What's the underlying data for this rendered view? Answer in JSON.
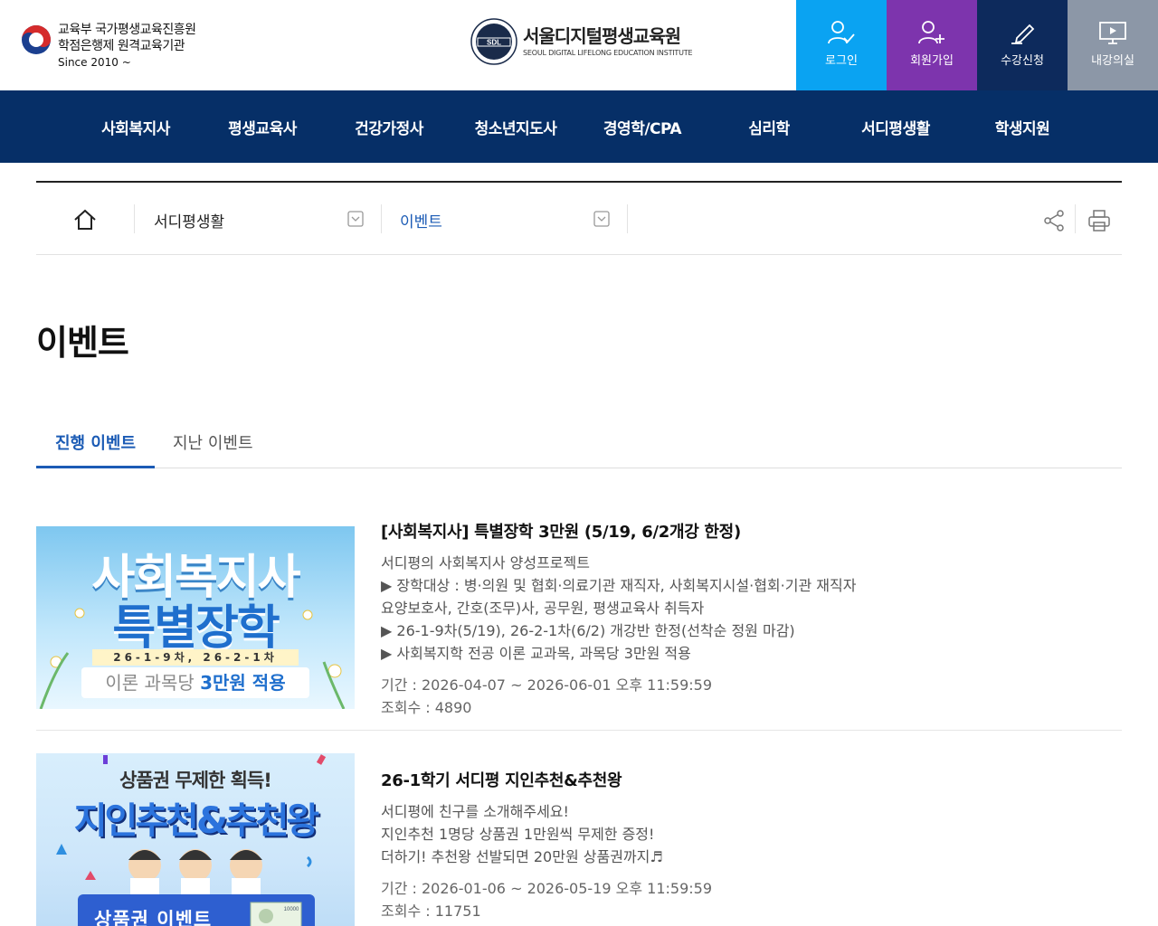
{
  "header": {
    "gov_line1": "교육부 국가평생교육진흥원",
    "gov_line2": "학점은행제 원격교육기관",
    "gov_since": "Since 2010 ~",
    "brand_name": "서울디지털평생교육원",
    "brand_sub": "SEOUL DIGITAL LIFELONG EDUCATION INSTITUTE",
    "brand_seal_text": "SDL",
    "quick": [
      {
        "label": "로그인",
        "icon": "user-check-icon",
        "color": "#0aa3f2"
      },
      {
        "label": "회원가입",
        "icon": "user-plus-icon",
        "color": "#7d34ad"
      },
      {
        "label": "수강신청",
        "icon": "pen-icon",
        "color": "#0d2a5c"
      },
      {
        "label": "내강의실",
        "icon": "monitor-icon",
        "color": "#8c97a7"
      }
    ]
  },
  "gnb": [
    "사회복지사",
    "평생교육사",
    "건강가정사",
    "청소년지도사",
    "경영학/CPA",
    "심리학",
    "서디평생활",
    "학생지원"
  ],
  "location": {
    "level1": "서디평생활",
    "level2": "이벤트"
  },
  "page_title": "이벤트",
  "tabs": [
    "진행 이벤트",
    "지난 이벤트"
  ],
  "events": [
    {
      "title": "[사회복지사] 특별장학 3만원 (5/19, 6/2개강 한정)",
      "desc": [
        "서디평의 사회복지사 양성프로젝트",
        "▶ 장학대상 : 병·의원 및 협회·의료기관 재직자, 사회복지시설·협회·기관 재직자",
        "요양보호사, 간호(조무)사, 공무원, 평생교육사 취득자",
        "▶ 26-1-9차(5/19), 26-2-1차(6/2) 개강반 한정(선착순 정원 마감)",
        "▶ 사회복지학 전공 이론 교과목, 과목당 3만원 적용"
      ],
      "period": "기간 : 2026-04-07 ~ 2026-06-01 오후 11:59:59",
      "views": "조회수 : 4890",
      "thumb": {
        "line1": "사회복지사",
        "line2": "특별장학",
        "band": "26-1-9차, 26-2-1차",
        "strip_prefix": "이론 과목당 ",
        "strip_bold": "3만원 적용"
      }
    },
    {
      "title": "26-1학기 서디평 지인추천&추천왕",
      "desc": [
        "서디평에 친구를 소개해주세요!",
        "지인추천 1명당 상품권 1만원씩 무제한 증정!",
        "더하기! 추천왕 선발되면 20만원 상품권까지♬"
      ],
      "period": "기간 : 2026-01-06 ~ 2026-05-19 오후 11:59:59",
      "views": "조회수 : 11751",
      "thumb": {
        "line1": "상품권 무제한 획득!",
        "line2": "지인추천&추천왕",
        "band": "상품권 이벤트",
        "bill": "10000"
      }
    }
  ]
}
